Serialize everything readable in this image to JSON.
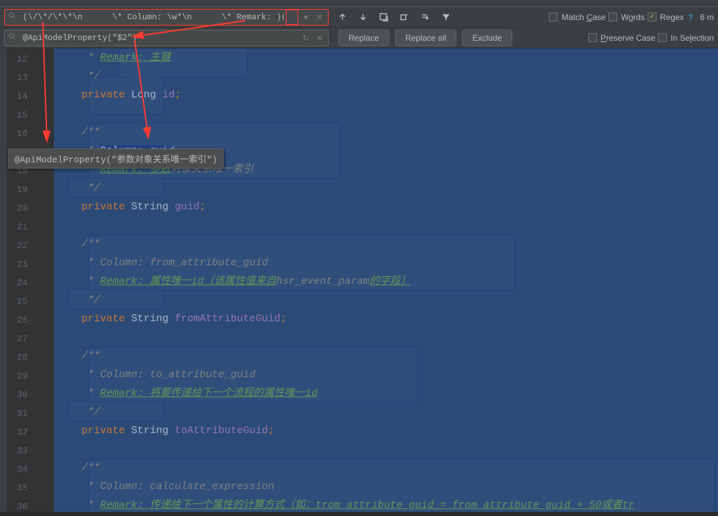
{
  "find": {
    "icon": "Q:-",
    "value": "(\\/\\*/\\*\\*\\n      \\* Column: \\w*\\n      \\* Remark: )(.*)(\\n     \\*\\/)",
    "count": "6 m"
  },
  "replace": {
    "icon": "Q:-",
    "value": "@ApiModelProperty(\"$2\")"
  },
  "buttons": {
    "replace": "Replace",
    "replace_all": "Replace all",
    "exclude": "Exclude"
  },
  "options": {
    "match_case": "Match Case",
    "words": "Words",
    "regex": "Regex",
    "preserve_case": "Preserve Case",
    "in_selection": "In Selection",
    "help": "?"
  },
  "tooltip": "@ApiModelProperty(\"参数对象关系唯一索引\")",
  "code": {
    "lines": [
      {
        "n": 12,
        "html": "     <span class='comment'>* </span><span class='comment-em'>Remark: 主键</span>"
      },
      {
        "n": 13,
        "html": "     <span class='comment'>*/</span>"
      },
      {
        "n": 14,
        "html": "    <span class='kw'>private</span> <span class='type'>Long</span> <span class='field'>id</span><span class='semi'>;</span>"
      },
      {
        "n": 15,
        "html": ""
      },
      {
        "n": 16,
        "html": "    <span class='comment'>/**</span>"
      },
      {
        "n": 17,
        "html": "     <span class='comment'>* </span><span class='sel-highlight'>Column: guid</span>"
      },
      {
        "n": 18,
        "html": "     <span class='comment'>* </span><span class='comment-em'>Remark: 参数</span><span class='comment-col'>对象关系唯一索引</span>"
      },
      {
        "n": 19,
        "html": "     <span class='comment'>*/</span>"
      },
      {
        "n": 20,
        "html": "    <span class='kw'>private</span> <span class='type'>String</span> <span class='field'>guid</span><span class='semi'>;</span>"
      },
      {
        "n": 21,
        "html": ""
      },
      {
        "n": 22,
        "html": "    <span class='comment'>/**</span>"
      },
      {
        "n": 23,
        "html": "     <span class='comment'>* </span><span class='comment-col'>Column: from_attribute_guid</span>"
      },
      {
        "n": 24,
        "html": "     <span class='comment'>* </span><span class='comment-em'>Remark: 属性唯一id（该属性值来自</span><span class='comment-col'>hsr_event_param</span><span class='comment-em'>的字段）</span>"
      },
      {
        "n": 25,
        "html": "     <span class='comment'>*/</span>"
      },
      {
        "n": 26,
        "html": "    <span class='kw'>private</span> <span class='type'>String</span> <span class='field'>fromAttributeGuid</span><span class='semi'>;</span>"
      },
      {
        "n": 27,
        "html": ""
      },
      {
        "n": 28,
        "html": "    <span class='comment'>/**</span>"
      },
      {
        "n": 29,
        "html": "     <span class='comment'>* </span><span class='comment-col'>Column: to_attribute_guid</span>"
      },
      {
        "n": 30,
        "html": "     <span class='comment'>* </span><span class='comment-em'>Remark: 将要传递给下一个流程的属性唯一id</span>"
      },
      {
        "n": 31,
        "html": "     <span class='comment'>*/</span>"
      },
      {
        "n": 32,
        "html": "    <span class='kw'>private</span> <span class='type'>String</span> <span class='field'>toAttributeGuid</span><span class='semi'>;</span>"
      },
      {
        "n": 33,
        "html": ""
      },
      {
        "n": 34,
        "html": "    <span class='comment'>/**</span>"
      },
      {
        "n": 35,
        "html": "     <span class='comment'>* </span><span class='comment-col'>Column: calculate_expression</span>"
      },
      {
        "n": 36,
        "html": "     <span class='comment'>* </span><span class='comment-em'>Remark: 传递给下一个属性的计算方式（如：trom_attribute_guid = from_attribute_guid + 50或者tr</span>"
      }
    ]
  }
}
